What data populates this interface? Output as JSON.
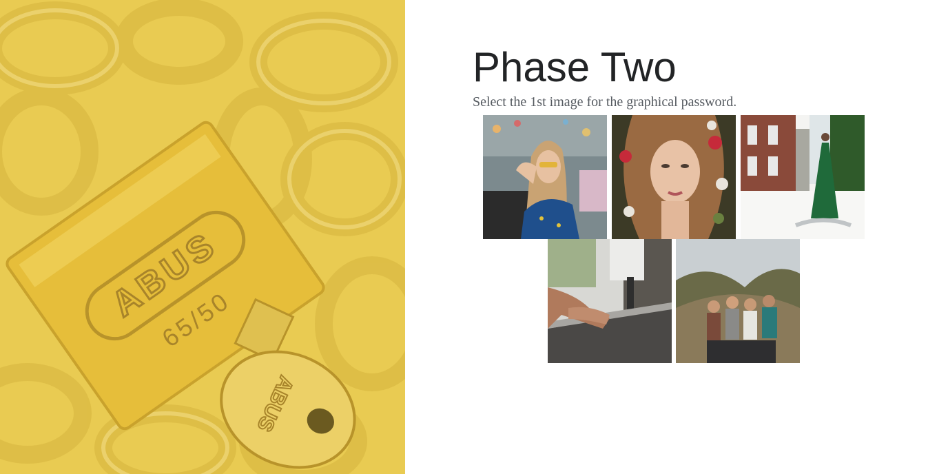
{
  "heading": {
    "title": "Phase Two",
    "instruction": "Select the 1st image for the graphical password."
  },
  "hero_image": {
    "subject": "padlock with key on chains, yellow tint",
    "lock_brand": "ABUS",
    "lock_model": "65/50",
    "key_brand": "ABUS",
    "tint_color": "#e8c84a"
  },
  "image_choices": [
    {
      "subject": "woman with sunglasses in blue shirt"
    },
    {
      "subject": "woman lying among flowers"
    },
    {
      "subject": "woman in green dress walking"
    },
    {
      "subject": "hands using a sewing machine"
    },
    {
      "subject": "group of friends hiking outdoors"
    }
  ]
}
